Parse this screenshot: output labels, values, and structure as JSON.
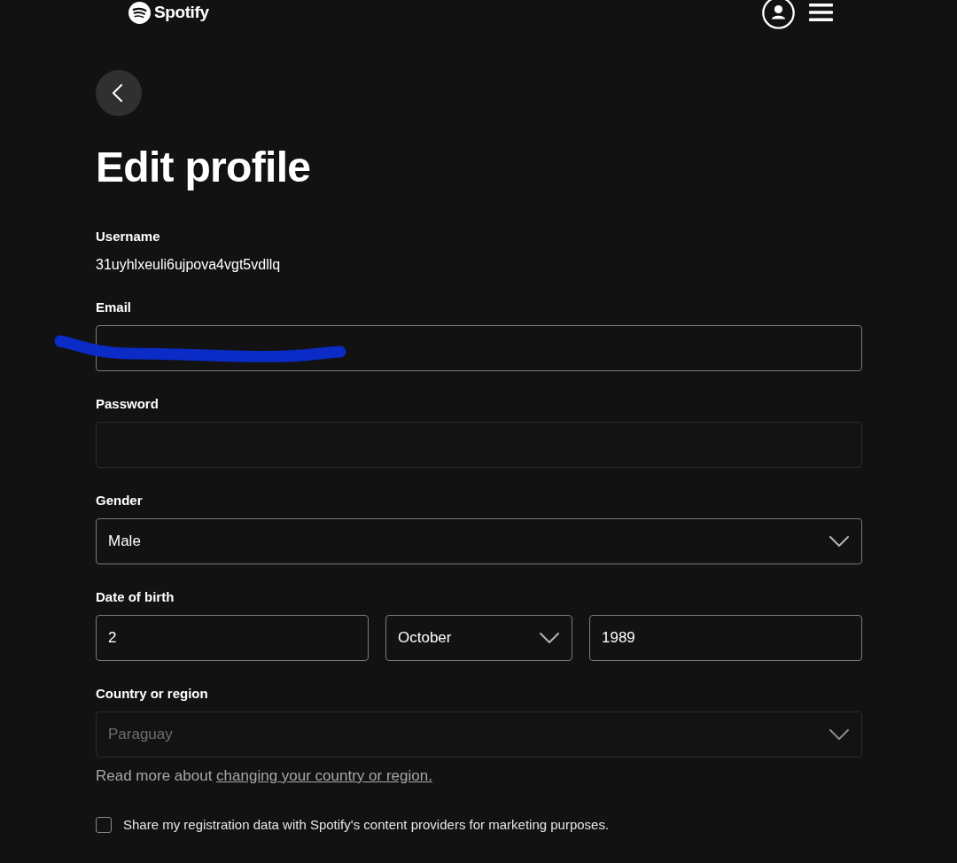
{
  "header": {
    "logo": "Spotify"
  },
  "page": {
    "title": "Edit profile"
  },
  "sections": [
    {
      "kind": "text",
      "label": "Username",
      "value": "31uyhlxeuli6ujpova4vgt5vdllq"
    },
    {
      "kind": "fields",
      "label": "Email",
      "inputs": [
        {
          "kind": "input",
          "disabled": false,
          "redacted": true
        }
      ]
    },
    {
      "kind": "fields",
      "label": "Password",
      "inputs": [
        {
          "kind": "input",
          "disabled": true,
          "redacted": false
        }
      ]
    },
    {
      "kind": "fields",
      "label": "Gender",
      "inputs": [
        {
          "kind": "select",
          "value": "Male",
          "disabled": false,
          "redacted": false
        }
      ]
    },
    {
      "kind": "fields",
      "label": "Date of birth",
      "inputs": [
        {
          "kind": "input",
          "value": "2",
          "disabled": false,
          "redacted": false
        },
        {
          "kind": "select",
          "value": "October",
          "disabled": false,
          "redacted": false
        },
        {
          "kind": "input",
          "value": "1989",
          "disabled": false,
          "redacted": false
        }
      ]
    },
    {
      "kind": "fields",
      "label": "Country or region",
      "inputs": [
        {
          "kind": "select",
          "value": "Paraguay",
          "disabled": true,
          "redacted": false
        }
      ],
      "note": {
        "text": "Read more about ",
        "link": "changing your country or region."
      }
    }
  ],
  "consent": {
    "label": "Share my registration data with Spotify's content providers for marketing purposes.",
    "checked": false
  }
}
